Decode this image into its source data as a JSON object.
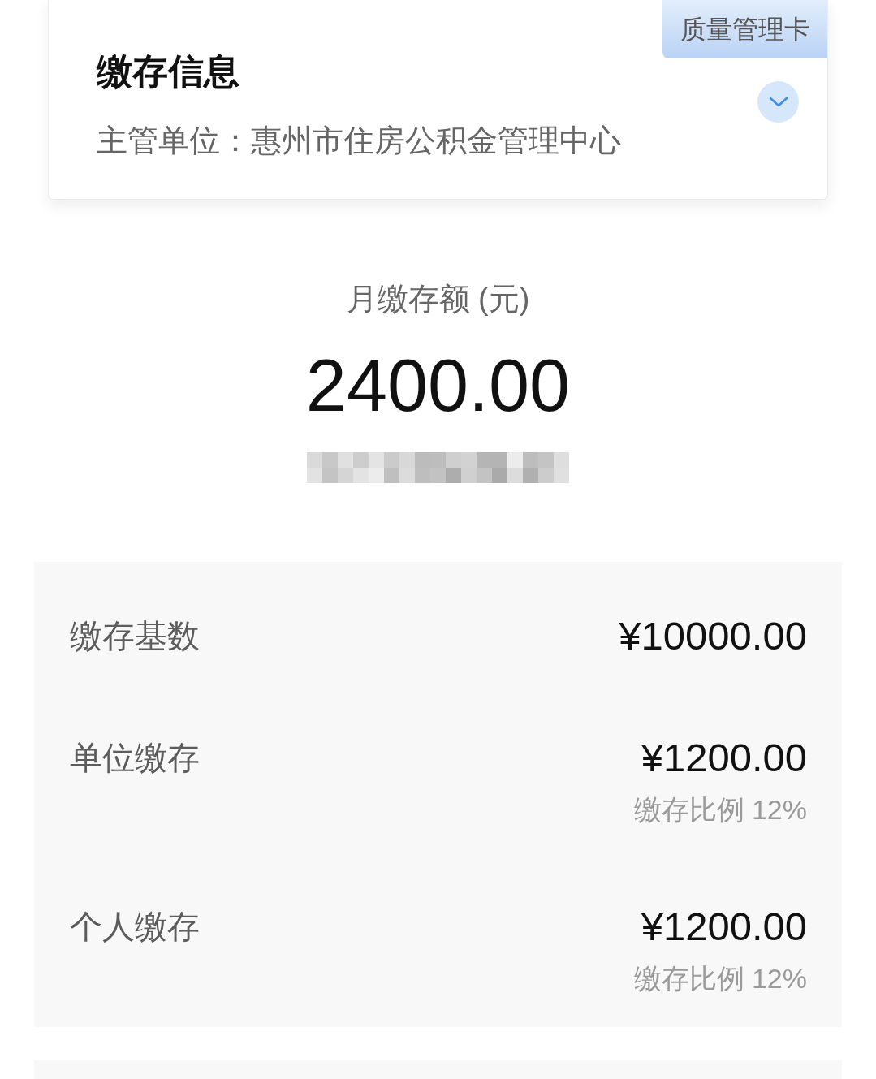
{
  "info_card": {
    "badge": "质量管理卡",
    "title": "缴存信息",
    "subtitle": "主管单位：惠州市住房公积金管理中心",
    "expanded": false
  },
  "monthly": {
    "label": "月缴存额 (元)",
    "amount": "2400.00"
  },
  "details": {
    "rows": [
      {
        "label": "缴存基数",
        "value": "¥10000.00"
      },
      {
        "label": "单位缴存",
        "value": "¥1200.00",
        "note": "缴存比例 12%"
      },
      {
        "label": "个人缴存",
        "value": "¥1200.00",
        "note": "缴存比例 12%"
      }
    ]
  }
}
